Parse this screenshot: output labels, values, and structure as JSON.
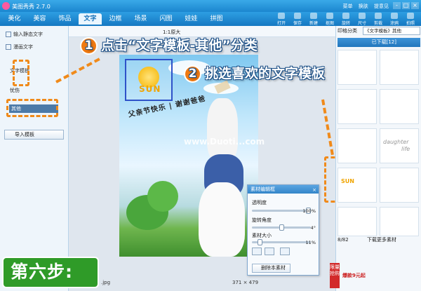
{
  "window": {
    "title": "美图秀秀 2.7.0",
    "links": [
      "菜单",
      "换肤",
      "提意见"
    ],
    "buttons": [
      "-",
      "□",
      "×"
    ]
  },
  "tabs": [
    "美化",
    "美容",
    "饰品",
    "文字",
    "边框",
    "场景",
    "闪图",
    "娃娃",
    "拼图"
  ],
  "active_tab": "文字",
  "toolbar": [
    {
      "label": "打开",
      "icon": "open-icon"
    },
    {
      "label": "保存",
      "icon": "save-icon"
    },
    {
      "label": "新建",
      "icon": "new-icon"
    },
    {
      "label": "抠图",
      "icon": "cutout-icon"
    },
    {
      "label": "旋转",
      "icon": "rotate-icon"
    },
    {
      "label": "尺寸",
      "icon": "resize-icon"
    },
    {
      "label": "剪裁",
      "icon": "crop-icon"
    },
    {
      "label": "涂鸦",
      "icon": "doodle-icon"
    },
    {
      "label": "拍照",
      "icon": "camera-icon"
    }
  ],
  "left_panel": {
    "items": [
      "输入静态文字",
      "漫画文字"
    ],
    "section": "文字模板",
    "categories": [
      "忧伤",
      "其他"
    ],
    "selected": "其他",
    "import_label": "导入模板"
  },
  "canvas": {
    "zoom": "1:1原大",
    "size": "371 × 479",
    "filename": ".jpg",
    "watermark": "www.Duoti...com"
  },
  "photo_text": {
    "sun": "SUN",
    "banner": "父亲节快乐 | 谢谢爸爸"
  },
  "callouts": [
    {
      "num": "1",
      "text": "点击“文字模板-其他”分类"
    },
    {
      "num": "2",
      "text": "挑选喜欢的文字模板"
    }
  ],
  "right_panel": {
    "header": "印格分类",
    "select": "《文字模板》其他",
    "downloaded": "已下载[12]",
    "thumb_text": [
      "daughter",
      "life",
      "SUN"
    ],
    "pager": "8/82",
    "download_more": "下载更多素材"
  },
  "material_panel": {
    "title": "素材编辑框",
    "close": "×",
    "opacity_label": "透明度",
    "opacity_value": "100%",
    "opacity": 1.0,
    "rotate_label": "旋转角度",
    "rotate_value": "4°",
    "rotate": 0.51,
    "size_label": "素材大小",
    "size_value": "11%",
    "size": 0.11,
    "delete_label": "删除本素材"
  },
  "step_badge": "第六步:",
  "ad": {
    "tag": "限量抢购",
    "text": "爆款9元起"
  },
  "colors": {
    "accent": "#1b86cf",
    "orange": "#f08a1a",
    "green": "#2f9b28"
  }
}
